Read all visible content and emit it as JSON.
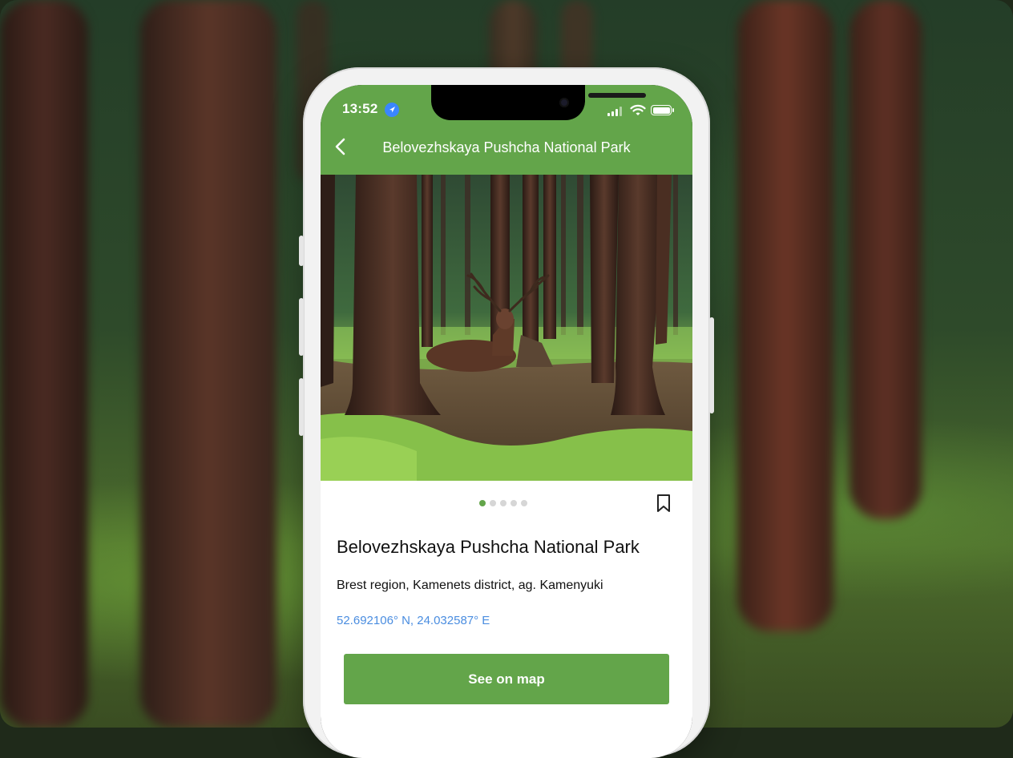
{
  "status_bar": {
    "time": "13:52"
  },
  "header": {
    "back_icon": "chevron-left-icon",
    "title": "Belovezhskaya Pushcha National Park"
  },
  "gallery": {
    "photo_count": 5,
    "active_index": 0,
    "bookmark_icon": "bookmark-icon"
  },
  "place": {
    "name": "Belovezhskaya Pushcha National Park",
    "address": "Brest region, Kamenets district, ag. Kamenyuki",
    "coordinates": "52.692106° N, 24.032587° E"
  },
  "actions": {
    "see_on_map_label": "See on map"
  },
  "colors": {
    "accent": "#63a54a",
    "link": "#4a8de0"
  }
}
